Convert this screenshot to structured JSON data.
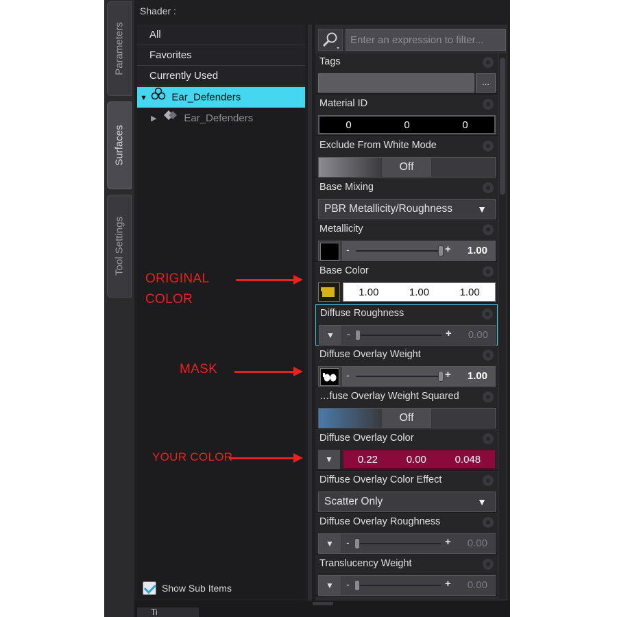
{
  "tabs": [
    {
      "label": "Parameters",
      "active": false
    },
    {
      "label": "Surfaces",
      "active": true
    },
    {
      "label": "Tool Settings",
      "active": false
    }
  ],
  "panel": {
    "shader_label": "Shader :",
    "tree": {
      "items": [
        {
          "label": "All"
        },
        {
          "label": "Favorites"
        },
        {
          "label": "Currently Used"
        },
        {
          "label": "Ear_Defenders",
          "selected": true,
          "icon": "figure-icon"
        },
        {
          "label": "Ear_Defenders",
          "child": true,
          "icon": "surface-icon"
        }
      ],
      "show_sub_items": {
        "label": "Show Sub Items",
        "checked": true
      }
    },
    "filter": {
      "placeholder": "Enter an expression to filter..."
    },
    "properties": {
      "tags": {
        "title": "Tags",
        "button": "..."
      },
      "material_id": {
        "title": "Material ID",
        "values": [
          "0",
          "0",
          "0"
        ]
      },
      "exclude_white": {
        "title": "Exclude From White Mode",
        "value": "Off"
      },
      "base_mixing": {
        "title": "Base Mixing",
        "value": "PBR Metallicity/Roughness"
      },
      "metallicity": {
        "title": "Metallicity",
        "value": "1.00",
        "level": 1.0
      },
      "base_color": {
        "title": "Base Color",
        "values": [
          "1.00",
          "1.00",
          "1.00"
        ]
      },
      "diffuse_roughness": {
        "title": "Diffuse Roughness",
        "value": "0.00",
        "level": 0.0
      },
      "overlay_weight": {
        "title": "Diffuse Overlay Weight",
        "value": "1.00",
        "level": 1.0
      },
      "overlay_weight_sq": {
        "title": "…fuse Overlay Weight Squared",
        "value": "Off"
      },
      "overlay_color": {
        "title": "Diffuse Overlay Color",
        "values": [
          "0.22",
          "0.00",
          "0.048"
        ],
        "swatch": "#8a0a3c"
      },
      "overlay_color_effect": {
        "title": "Diffuse Overlay Color Effect",
        "value": "Scatter Only"
      },
      "overlay_roughness": {
        "title": "Diffuse Overlay Roughness",
        "value": "0.00",
        "level": 0.0
      },
      "translucency_weight": {
        "title": "Translucency Weight",
        "value": "0.00",
        "level": 0.0
      }
    }
  },
  "bottom_tab": "Ti",
  "annotations": [
    {
      "text": "ORIGINAL\nCOLOR",
      "color": "#e8221e"
    },
    {
      "text": "MASK",
      "color": "#e8221e"
    },
    {
      "text": "YOUR COLOR",
      "color": "#e8221e"
    }
  ],
  "colors": {
    "selection": "#45d6f0",
    "annotation": "#e8221e",
    "overlay": "#8a0a3c"
  }
}
